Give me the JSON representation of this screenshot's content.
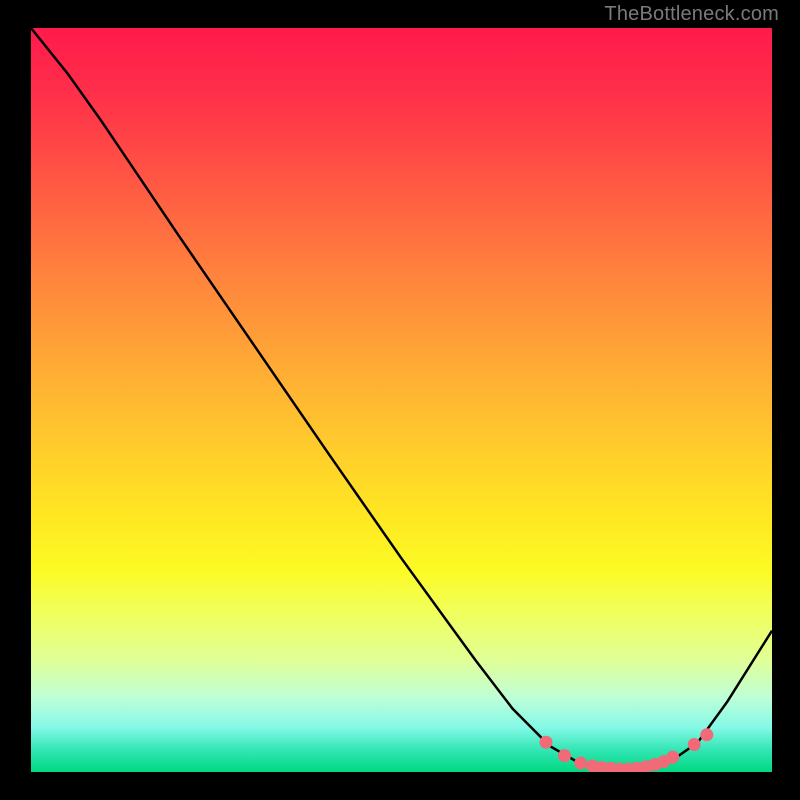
{
  "attribution": "TheBottleneck.com",
  "chart_data": {
    "type": "line",
    "title": "",
    "xlabel": "",
    "ylabel": "",
    "xlim": [
      0,
      1
    ],
    "ylim": [
      0,
      1
    ],
    "series": [
      {
        "name": "curve",
        "points": [
          {
            "x": 0.0,
            "y": 1.0
          },
          {
            "x": 0.05,
            "y": 0.938
          },
          {
            "x": 0.095,
            "y": 0.875
          },
          {
            "x": 0.2,
            "y": 0.72
          },
          {
            "x": 0.3,
            "y": 0.575
          },
          {
            "x": 0.4,
            "y": 0.43
          },
          {
            "x": 0.5,
            "y": 0.287
          },
          {
            "x": 0.6,
            "y": 0.15
          },
          {
            "x": 0.65,
            "y": 0.085
          },
          {
            "x": 0.7,
            "y": 0.035
          },
          {
            "x": 0.74,
            "y": 0.012
          },
          {
            "x": 0.78,
            "y": 0.004
          },
          {
            "x": 0.82,
            "y": 0.004
          },
          {
            "x": 0.86,
            "y": 0.012
          },
          {
            "x": 0.9,
            "y": 0.04
          },
          {
            "x": 0.94,
            "y": 0.095
          },
          {
            "x": 1.0,
            "y": 0.19
          }
        ]
      },
      {
        "name": "markers",
        "points": [
          {
            "x": 0.695,
            "y": 0.04
          },
          {
            "x": 0.72,
            "y": 0.022
          },
          {
            "x": 0.742,
            "y": 0.012
          },
          {
            "x": 0.758,
            "y": 0.008
          },
          {
            "x": 0.77,
            "y": 0.006
          },
          {
            "x": 0.782,
            "y": 0.005
          },
          {
            "x": 0.794,
            "y": 0.004
          },
          {
            "x": 0.806,
            "y": 0.004
          },
          {
            "x": 0.818,
            "y": 0.005
          },
          {
            "x": 0.83,
            "y": 0.007
          },
          {
            "x": 0.842,
            "y": 0.01
          },
          {
            "x": 0.854,
            "y": 0.014
          },
          {
            "x": 0.866,
            "y": 0.02
          },
          {
            "x": 0.895,
            "y": 0.037
          },
          {
            "x": 0.912,
            "y": 0.05
          }
        ]
      }
    ],
    "marker_color": "#f06a78",
    "line_color": "#000000"
  }
}
